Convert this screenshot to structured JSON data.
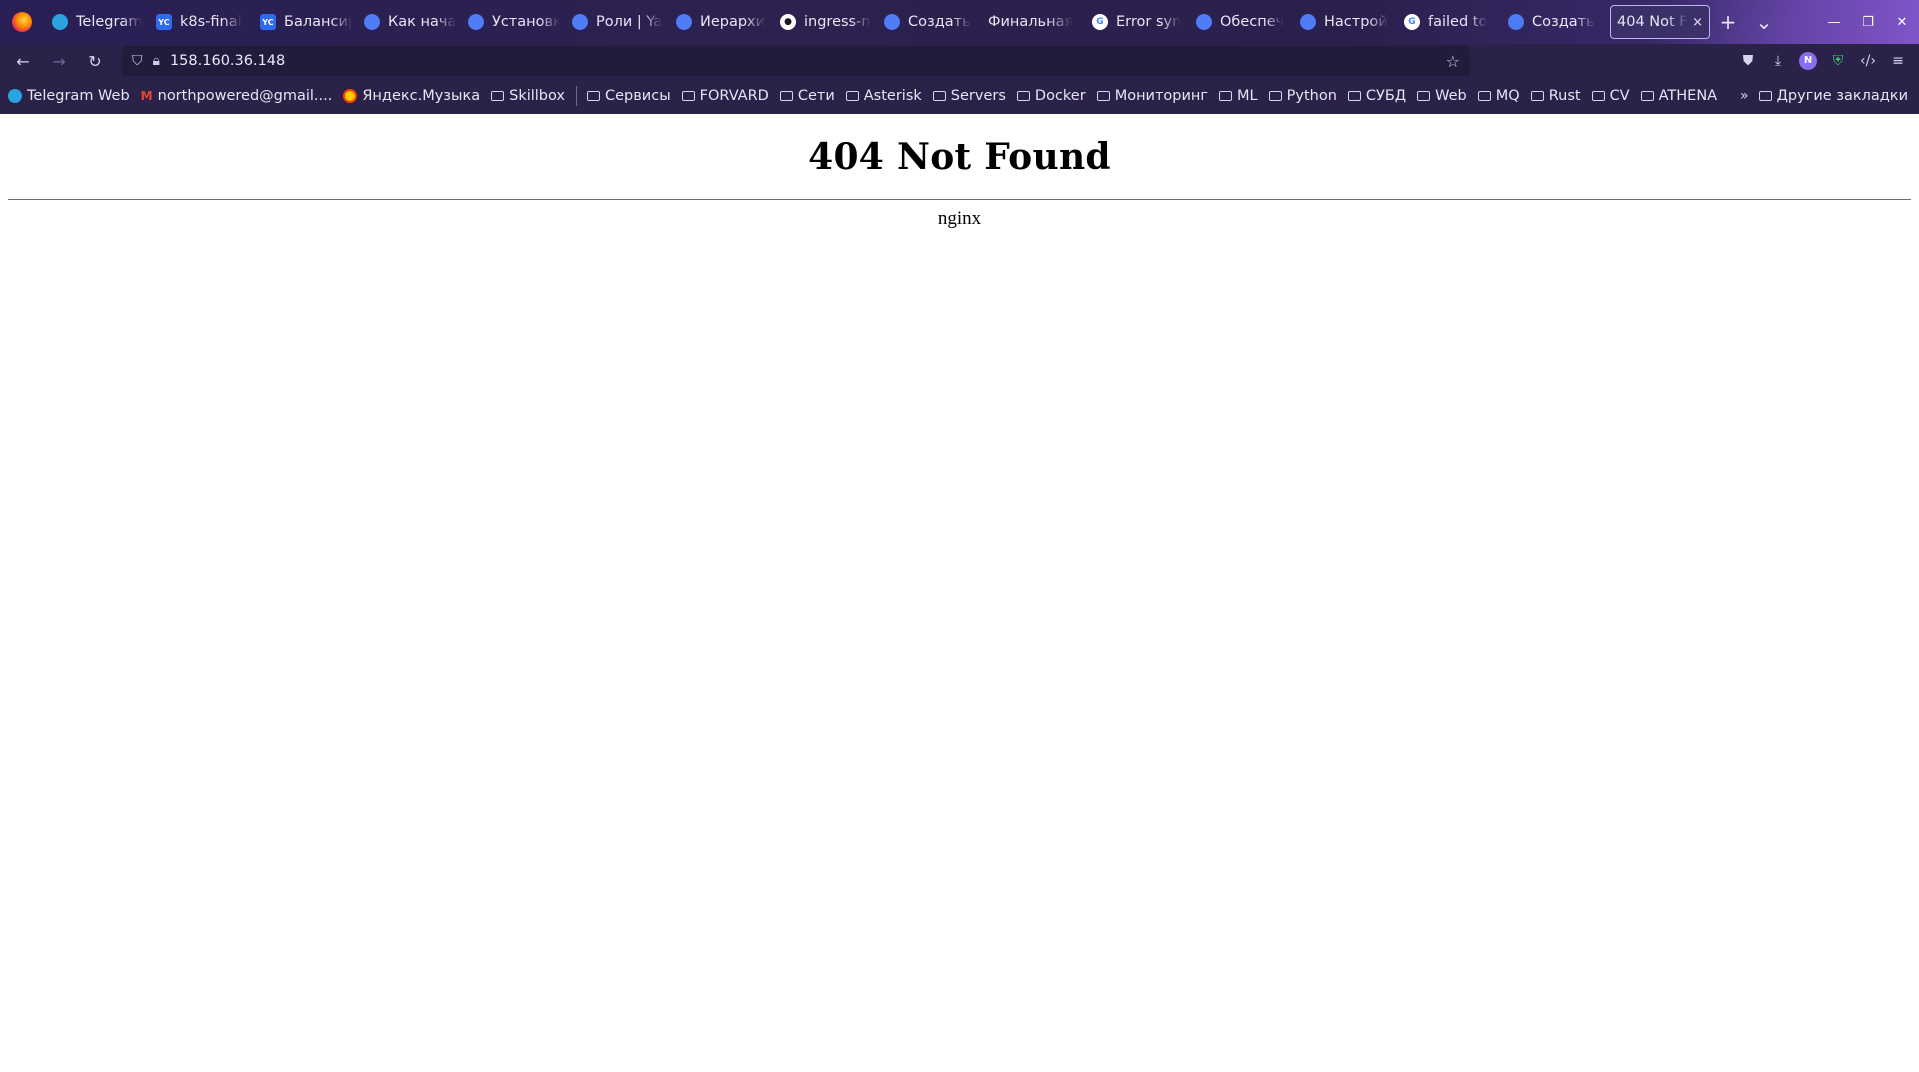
{
  "browser": {
    "tabs": [
      {
        "label": "Telegram",
        "favicon": "telegram-icon"
      },
      {
        "label": "k8s-final",
        "favicon": "yandex-cloud-icon"
      },
      {
        "label": "Балансир",
        "favicon": "yandex-cloud-icon"
      },
      {
        "label": "Как нача",
        "favicon": "doc-icon"
      },
      {
        "label": "Установк",
        "favicon": "doc-icon"
      },
      {
        "label": "Роли | Ya",
        "favicon": "doc-icon"
      },
      {
        "label": "Иерархи",
        "favicon": "doc-icon"
      },
      {
        "label": "ingress-n",
        "favicon": "github-icon"
      },
      {
        "label": "Создать",
        "favicon": "doc-icon"
      },
      {
        "label": "Финальная",
        "favicon": ""
      },
      {
        "label": "Error syn",
        "favicon": "google-icon"
      },
      {
        "label": "Обеспеч",
        "favicon": "doc-icon"
      },
      {
        "label": "Настрой",
        "favicon": "doc-icon"
      },
      {
        "label": "failed to",
        "favicon": "google-icon"
      },
      {
        "label": "Создать",
        "favicon": "doc-icon"
      }
    ],
    "active_tab": {
      "label": "404 Not Found",
      "close": "×"
    },
    "new_tab": "+",
    "list_tabs": "⌄",
    "url": "158.160.36.148",
    "bookmarks": [
      {
        "label": "Telegram Web",
        "icon": "telegram-icon"
      },
      {
        "label": "northpowered@gmail....",
        "icon": "gmail-icon"
      },
      {
        "label": "Яндекс.Музыка",
        "icon": "yandex-music-icon"
      },
      {
        "label": "Skillbox",
        "icon": "folder-icon"
      }
    ],
    "bookmark_folders": [
      "Сервисы",
      "FORVARD",
      "Сети",
      "Asterisk",
      "Servers",
      "Docker",
      "Мониторинг",
      "ML",
      "Python",
      "СУБД",
      "Web",
      "MQ",
      "Rust",
      "CV",
      "ATHENA"
    ],
    "other_bookmarks": "Другие закладки",
    "profile_initial": "N"
  },
  "page": {
    "title": "404 Not Found",
    "server": "nginx"
  }
}
